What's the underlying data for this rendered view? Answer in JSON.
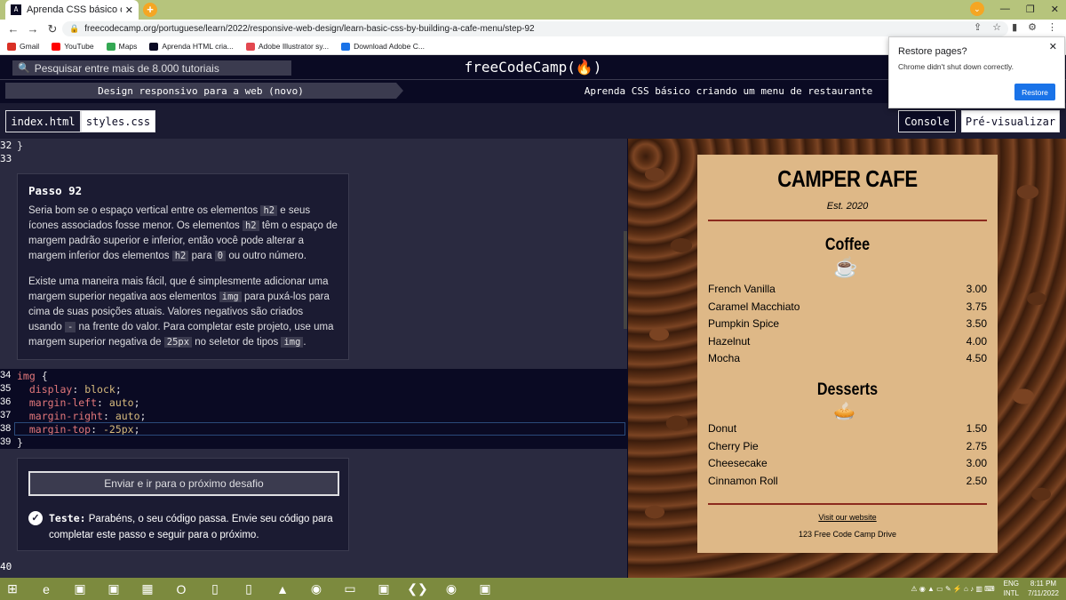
{
  "browser": {
    "tab_title": "Aprenda CSS básico criando um",
    "tab_favicon": "A",
    "url": "freecodecamp.org/portuguese/learn/2022/responsive-web-design/learn-basic-css-by-building-a-cafe-menu/step-92",
    "bookmarks": [
      {
        "label": "Gmail",
        "icon": "gmail-icon",
        "color": "#d93025"
      },
      {
        "label": "YouTube",
        "icon": "youtube-icon",
        "color": "#ff0000"
      },
      {
        "label": "Maps",
        "icon": "maps-icon",
        "color": "#34a853"
      },
      {
        "label": "Aprenda HTML cria...",
        "icon": "fcc-icon",
        "color": "#0a0a23"
      },
      {
        "label": "Adobe Illustrator sy...",
        "icon": "adobe-icon",
        "color": "#e34850"
      },
      {
        "label": "Download Adobe C...",
        "icon": "download-icon",
        "color": "#1a73e8"
      }
    ]
  },
  "popup": {
    "title": "Restore pages?",
    "message": "Chrome didn't shut down correctly.",
    "button": "Restore"
  },
  "fcc": {
    "search_placeholder": "Pesquisar entre mais de 8.000 tutoriais",
    "logo": "freeCodeCamp(🔥)",
    "breadcrumb_1": "Design responsivo para a web (novo)",
    "breadcrumb_2": "Aprenda CSS básico criando um menu de restaurante",
    "file_tabs": [
      "index.html",
      "styles.css"
    ],
    "console_label": "Console",
    "preview_label": "Pré-visualizar"
  },
  "editor": {
    "top_lines": [
      {
        "n": "32",
        "code": "}"
      },
      {
        "n": "33",
        "code": ""
      }
    ],
    "code_lines": [
      {
        "n": "34",
        "code": "img {"
      },
      {
        "n": "35",
        "code": "  display: block;"
      },
      {
        "n": "36",
        "code": "  margin-left: auto;"
      },
      {
        "n": "37",
        "code": "  margin-right: auto;"
      },
      {
        "n": "38",
        "code": "  margin-top: -25px;"
      },
      {
        "n": "39",
        "code": "}"
      }
    ],
    "bottom_line": "40"
  },
  "step": {
    "title": "Passo 92",
    "p1": [
      "Seria bom se o espaço vertical entre os elementos ",
      "h2",
      " e seus ícones associados fosse menor. Os elementos ",
      "h2",
      " têm o espaço de margem padrão superior e inferior, então você pode alterar a margem inferior dos elementos ",
      "h2",
      " para ",
      "0",
      " ou outro número."
    ],
    "p2": [
      "Existe uma maneira mais fácil, que é simplesmente adicionar uma margem superior negativa aos elementos ",
      "img",
      " para puxá-los para cima de suas posições atuais. Valores negativos são criados usando ",
      "-",
      " na frente do valor. Para completar este projeto, use uma margem superior negativa de ",
      "25px",
      " no seletor de tipos ",
      "img",
      "."
    ]
  },
  "check": {
    "submit_label": "Enviar e ir para o próximo desafio",
    "test_label": "Teste:",
    "test_message": "Parabéns, o seu código passa. Envie seu código para completar este passo e seguir para o próximo."
  },
  "cafe": {
    "title": "CAMPER CAFE",
    "est": "Est. 2020",
    "coffee_heading": "Coffee",
    "coffee": [
      {
        "name": "French Vanilla",
        "price": "3.00"
      },
      {
        "name": "Caramel Macchiato",
        "price": "3.75"
      },
      {
        "name": "Pumpkin Spice",
        "price": "3.50"
      },
      {
        "name": "Hazelnut",
        "price": "4.00"
      },
      {
        "name": "Mocha",
        "price": "4.50"
      }
    ],
    "desserts_heading": "Desserts",
    "desserts": [
      {
        "name": "Donut",
        "price": "1.50"
      },
      {
        "name": "Cherry Pie",
        "price": "2.75"
      },
      {
        "name": "Cheesecake",
        "price": "3.00"
      },
      {
        "name": "Cinnamon Roll",
        "price": "2.50"
      }
    ],
    "visit_link": "Visit our website",
    "address": "123 Free Code Camp Drive"
  },
  "taskbar": {
    "apps": [
      "start-icon",
      "edge-icon",
      "app-icon",
      "app-icon",
      "excel-icon",
      "opera-icon",
      "file-icon",
      "file-icon",
      "vlc-icon",
      "chrome-icon",
      "explorer-icon",
      "app-icon",
      "vscode-icon",
      "chrome-icon",
      "app-icon"
    ],
    "lang": "ENG",
    "layout": "INTL",
    "time": "8:11 PM",
    "date": "7/11/2022"
  }
}
